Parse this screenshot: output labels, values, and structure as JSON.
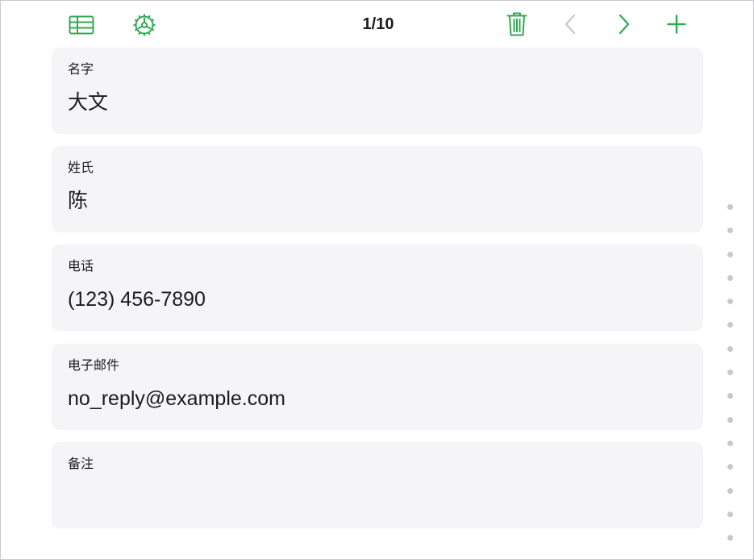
{
  "toolbar": {
    "table_view_icon": "table-grid-icon",
    "settings_icon": "gear-icon",
    "record_counter": "1/10",
    "delete_icon": "trash-icon",
    "previous_icon": "chevron-left-icon",
    "next_icon": "chevron-right-icon",
    "add_icon": "plus-icon"
  },
  "fields": [
    {
      "label": "名字",
      "value": "大文"
    },
    {
      "label": "姓氏",
      "value": "陈"
    },
    {
      "label": "电话",
      "value": "(123) 456-7890"
    },
    {
      "label": "电子邮件",
      "value": "no_reply@example.com"
    },
    {
      "label": "备注",
      "value": ""
    }
  ],
  "page_dots_count": 15,
  "colors": {
    "accent": "#34a853",
    "disabled": "#c7c7cc",
    "card_background": "#f5f5f7",
    "text": "#1c1c1e"
  }
}
